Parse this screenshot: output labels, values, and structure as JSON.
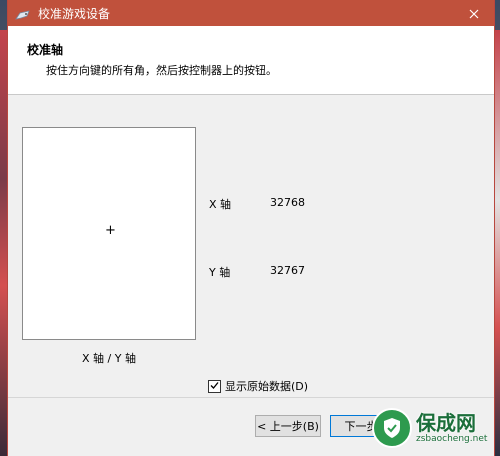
{
  "window": {
    "title": "校准游戏设备"
  },
  "header": {
    "title": "校准轴",
    "subtitle": "按住方向键的所有角，然后按控制器上的按钮。"
  },
  "plot": {
    "crosshair": "+",
    "caption": "X 轴 / Y 轴"
  },
  "axes": [
    {
      "label": "X 轴",
      "value": "32768"
    },
    {
      "label": "Y 轴",
      "value": "32767"
    }
  ],
  "raw_data_checkbox": {
    "label": "显示原始数据(D)",
    "checked": true
  },
  "buttons": {
    "back": "< 上一步(B)",
    "next": "下一步"
  },
  "watermark": {
    "main": "保成网",
    "url": "zsbaocheng.net"
  },
  "colors": {
    "titlebar": "#c0513c",
    "watermark_green": "#2d9a4e"
  }
}
